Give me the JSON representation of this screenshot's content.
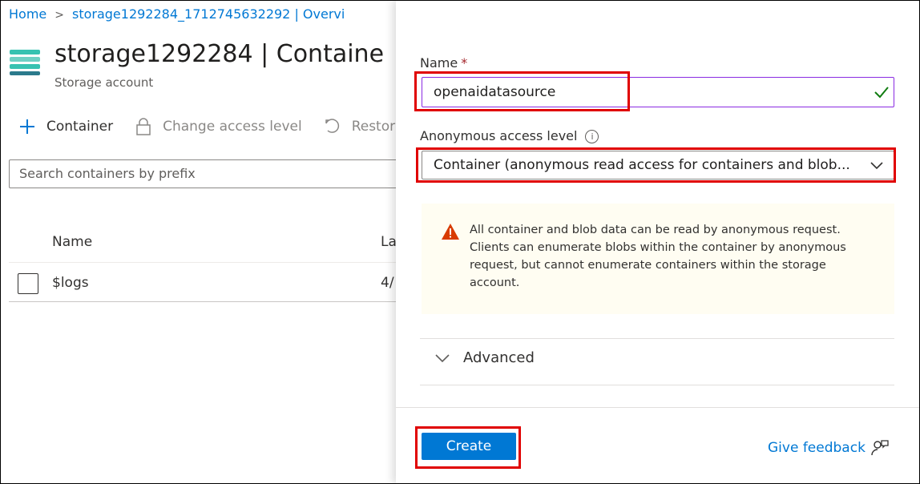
{
  "breadcrumb": {
    "home": "Home",
    "separator": ">",
    "current": "storage1292284_1712745632292 | Overvi"
  },
  "account": {
    "title": "storage1292284 | Containe",
    "subtitle": "Storage account",
    "icon": "storage-account-icon"
  },
  "toolbar": {
    "add_container": "Container",
    "change_access": "Change access level",
    "restore": "Restor"
  },
  "search": {
    "placeholder": "Search containers by prefix"
  },
  "table": {
    "headers": [
      "Name",
      "La"
    ],
    "rows": [
      {
        "name": "$logs",
        "last_modified": "4/"
      }
    ]
  },
  "panel": {
    "name_label": "Name",
    "required_mark": "*",
    "name_value": "openaidatasource",
    "access_label": "Anonymous access level",
    "access_value": "Container (anonymous read access for containers and blob...",
    "warning_text": "All container and blob data can be read by anonymous request. Clients can enumerate blobs within the container by anonymous request, but cannot enumerate containers within the storage account.",
    "advanced_label": "Advanced",
    "create_label": "Create",
    "feedback_label": "Give feedback"
  },
  "colors": {
    "accent": "#0078d4",
    "highlight": "#e00000",
    "valid": "#107c10",
    "warning": "#d83b01",
    "input_focus": "#8a2be2"
  }
}
